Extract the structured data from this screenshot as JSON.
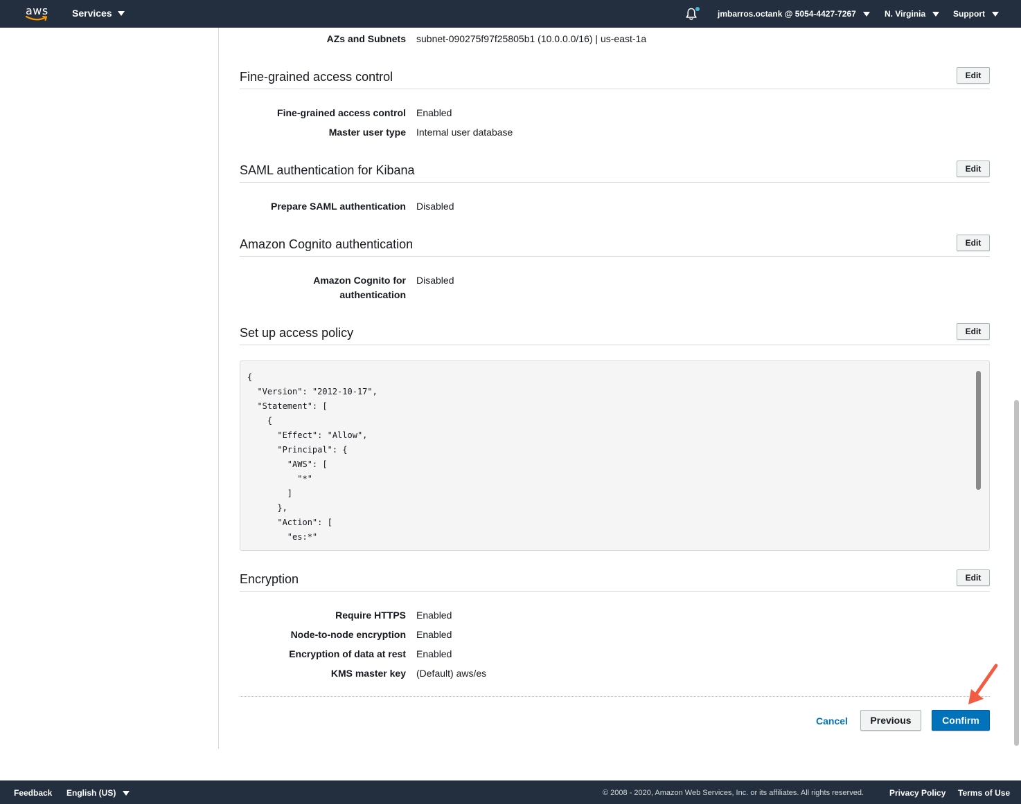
{
  "nav": {
    "logo": "aws",
    "services": "Services",
    "account": "jmbarros.octank @ 5054-4427-7267",
    "region": "N. Virginia",
    "support": "Support",
    "colors": {
      "bar": "#232f3e",
      "accent": "#ff9900",
      "notification": "#44b9d6"
    },
    "icons": [
      "bell-icon",
      "caret-down-icon"
    ]
  },
  "network": {
    "azs_label": "AZs and Subnets",
    "azs_value": "subnet-090275f97f25805b1 (10.0.0.0/16) | us-east-1a"
  },
  "fgac": {
    "title": "Fine-grained access control",
    "edit": "Edit",
    "fields": [
      {
        "label": "Fine-grained access control",
        "value": "Enabled"
      },
      {
        "label": "Master user type",
        "value": "Internal user database"
      }
    ]
  },
  "saml": {
    "title": "SAML authentication for Kibana",
    "edit": "Edit",
    "fields": [
      {
        "label": "Prepare SAML authentication",
        "value": "Disabled"
      }
    ]
  },
  "cognito": {
    "title": "Amazon Cognito authentication",
    "edit": "Edit",
    "label_line1": "Amazon Cognito for",
    "label_line2": "authentication",
    "value": "Disabled"
  },
  "policy": {
    "title": "Set up access policy",
    "edit": "Edit",
    "code": "{\n  \"Version\": \"2012-10-17\",\n  \"Statement\": [\n    {\n      \"Effect\": \"Allow\",\n      \"Principal\": {\n        \"AWS\": [\n          \"*\"\n        ]\n      },\n      \"Action\": [\n        \"es:*\""
  },
  "encryption": {
    "title": "Encryption",
    "edit": "Edit",
    "fields": [
      {
        "label": "Require HTTPS",
        "value": "Enabled"
      },
      {
        "label": "Node-to-node encryption",
        "value": "Enabled"
      },
      {
        "label": "Encryption of data at rest",
        "value": "Enabled"
      },
      {
        "label": "KMS master key",
        "value": "(Default) aws/es"
      }
    ]
  },
  "actions": {
    "cancel": "Cancel",
    "previous": "Previous",
    "confirm": "Confirm",
    "confirm_color": "#0073bb",
    "arrow_color": "#f25c43"
  },
  "footer": {
    "feedback": "Feedback",
    "language": "English (US)",
    "copyright": "© 2008 - 2020, Amazon Web Services, Inc. or its affiliates. All rights reserved.",
    "privacy": "Privacy Policy",
    "terms": "Terms of Use"
  }
}
